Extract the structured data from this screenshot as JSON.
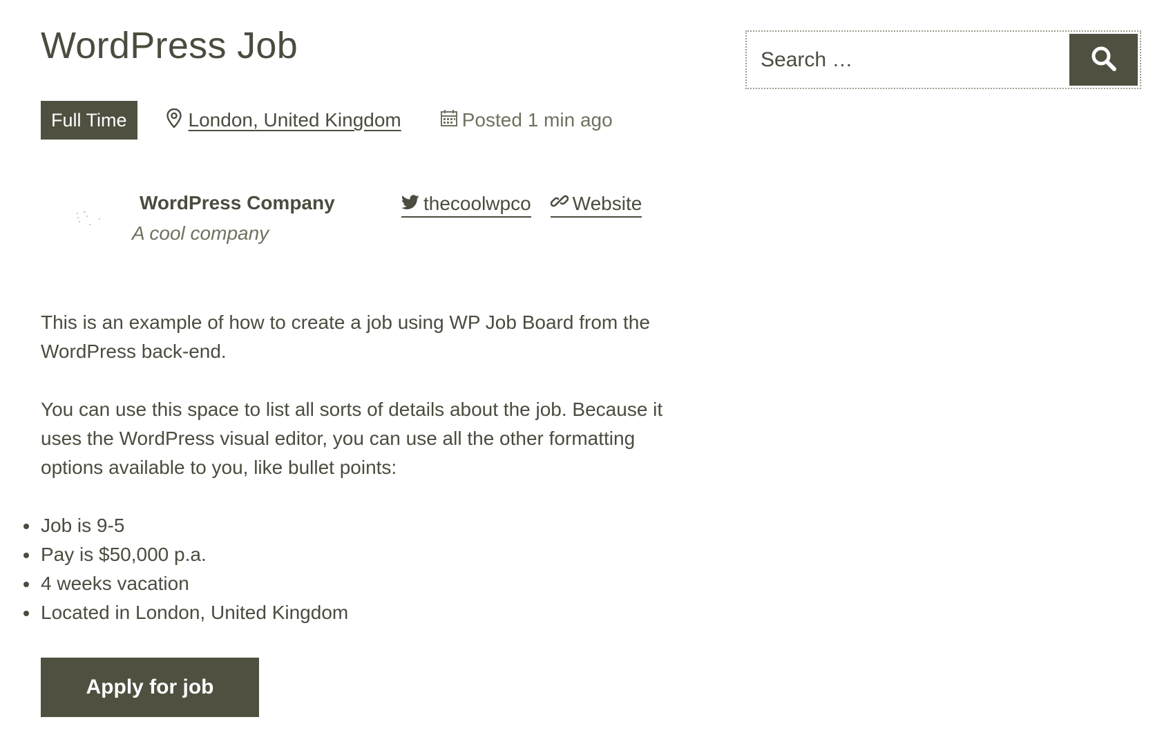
{
  "job": {
    "title": "WordPress Job",
    "type": "Full Time",
    "location": "London, United Kingdom",
    "posted": "Posted 1 min ago"
  },
  "company": {
    "name": "WordPress Company",
    "tagline": "A cool company",
    "twitter": "thecoolwpco",
    "website_label": "Website"
  },
  "description": {
    "paragraphs": [
      "This is an example of how to create a job using WP Job Board from the WordPress back-end.",
      "You can use this space to list all sorts of details about the job. Because it uses the WordPress visual editor, you can use all the other formatting options available to you, like bullet points:"
    ],
    "bullets": [
      "Job is 9-5",
      "Pay is $50,000 p.a.",
      "4 weeks vacation",
      "Located in London, United Kingdom"
    ]
  },
  "apply": {
    "label": "Apply for job"
  },
  "search": {
    "placeholder": "Search …"
  },
  "colors": {
    "accent": "#4f5040",
    "text": "#4b4b3f",
    "muted": "#70705f"
  },
  "icons": {
    "location": "map-pin-icon",
    "posted": "calendar-icon",
    "twitter": "twitter-icon",
    "website": "link-icon",
    "search": "search-icon"
  }
}
